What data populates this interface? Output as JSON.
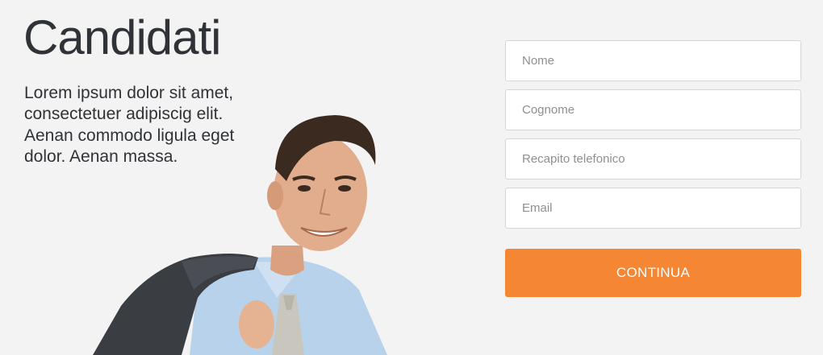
{
  "header": {
    "title": "Candidati",
    "intro": "Lorem ipsum dolor sit amet, consectetuer adipiscig elit. Aenan commodo ligula eget dolor. Aenan massa."
  },
  "form": {
    "fields": [
      {
        "name": "nome",
        "placeholder": "Nome"
      },
      {
        "name": "cognome",
        "placeholder": "Cognome"
      },
      {
        "name": "telefono",
        "placeholder": "Recapito telefonico"
      },
      {
        "name": "email",
        "placeholder": "Email"
      }
    ],
    "submit_label": "CONTINUA"
  },
  "colors": {
    "background": "#f3f3f3",
    "accent": "#f58634",
    "text": "#2f3237"
  }
}
